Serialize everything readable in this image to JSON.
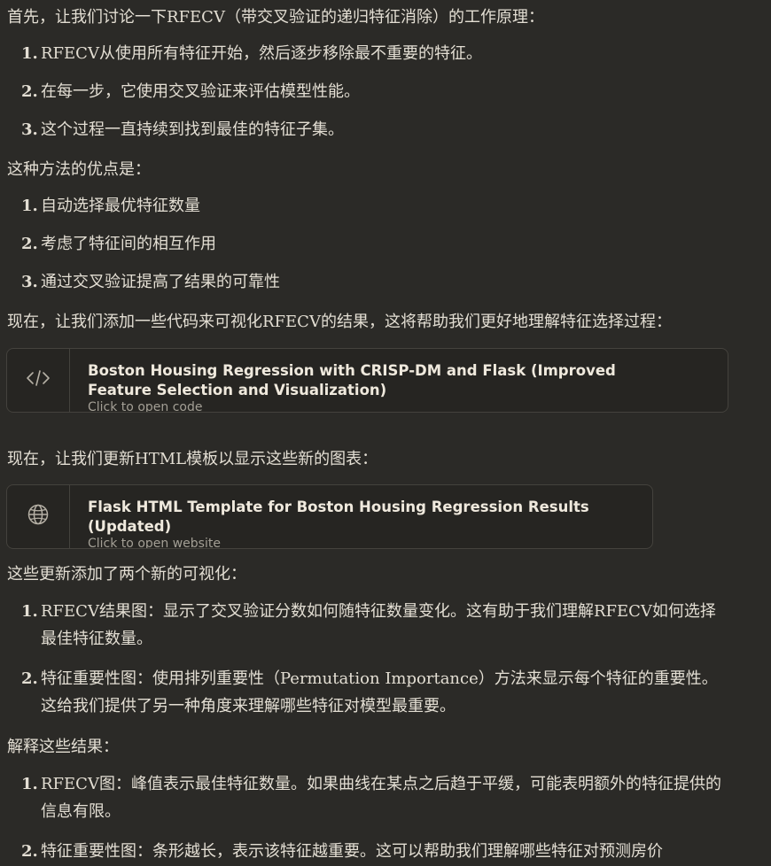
{
  "messages": {
    "p1": "首先，让我们讨论一下RFECV（带交叉验证的递归特征消除）的工作原理：",
    "list1": [
      {
        "num": "1.",
        "text": "RFECV从使用所有特征开始，然后逐步移除最不重要的特征。"
      },
      {
        "num": "2.",
        "text": "在每一步，它使用交叉验证来评估模型性能。"
      },
      {
        "num": "3.",
        "text": "这个过程一直持续到找到最佳的特征子集。"
      }
    ],
    "p2": "这种方法的优点是：",
    "list2": [
      {
        "num": "1.",
        "text": "自动选择最优特征数量"
      },
      {
        "num": "2.",
        "text": "考虑了特征间的相互作用"
      },
      {
        "num": "3.",
        "text": "通过交叉验证提高了结果的可靠性"
      }
    ],
    "p3": "现在，让我们添加一些代码来可视化RFECV的结果，这将帮助我们更好地理解特征选择过程：",
    "artifact1": {
      "icon": "code-icon",
      "title": "Boston Housing Regression with CRISP-DM and Flask (Improved Feature Selection and Visualization)",
      "subtitle": "Click to open code"
    },
    "p4": "现在，让我们更新HTML模板以显示这些新的图表：",
    "artifact2": {
      "icon": "globe-icon",
      "title": "Flask HTML Template for Boston Housing Regression Results (Updated)",
      "subtitle": "Click to open website"
    },
    "p5": "这些更新添加了两个新的可视化：",
    "list3": [
      {
        "num": "1.",
        "text": "RFECV结果图：显示了交叉验证分数如何随特征数量变化。这有助于我们理解RFECV如何选择最佳特征数量。"
      },
      {
        "num": "2.",
        "text": "特征重要性图：使用排列重要性（Permutation Importance）方法来显示每个特征的重要性。这给我们提供了另一种角度来理解哪些特征对模型最重要。"
      }
    ],
    "p6": "解释这些结果：",
    "list4": [
      {
        "num": "1.",
        "text": "RFECV图：峰值表示最佳特征数量。如果曲线在某点之后趋于平缓，可能表明额外的特征提供的信息有限。"
      },
      {
        "num": "2.",
        "text": "特征重要性图：条形越长，表示该特征越重要。这可以帮助我们理解哪些特征对预测房价"
      }
    ]
  },
  "colors": {
    "background": "#2b2a27",
    "text": "#e3ded3",
    "card": "#262522",
    "border": "#44423d",
    "muted": "#a39f95"
  }
}
